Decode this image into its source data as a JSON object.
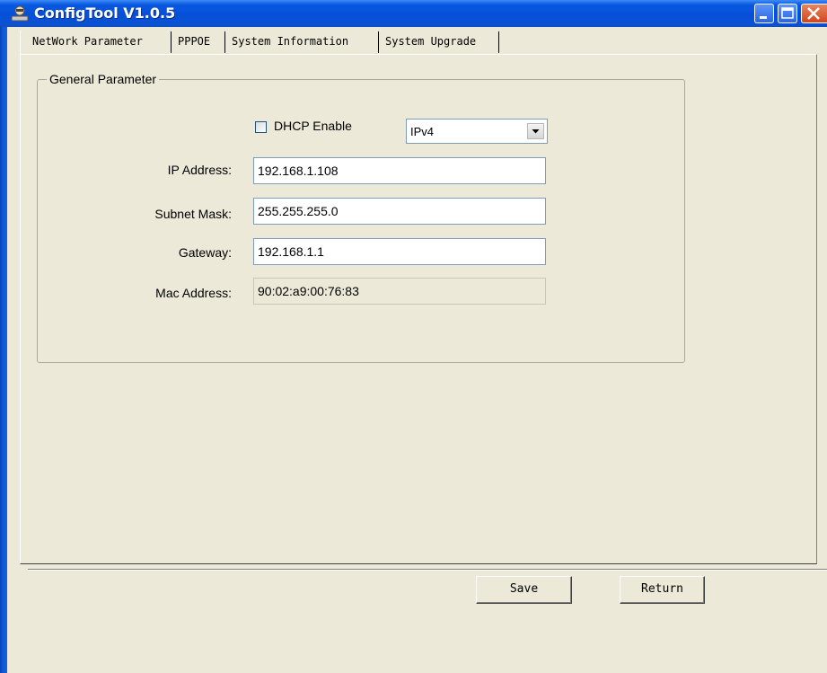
{
  "window": {
    "title": "ConfigTool V1.0.5",
    "icon": "network-tool-icon",
    "controls": [
      "minimize-icon",
      "maximize-icon",
      "close-icon"
    ]
  },
  "tabs": [
    {
      "label": "NetWork Parameter",
      "active": true
    },
    {
      "label": "PPPOE",
      "active": false
    },
    {
      "label": "System Information",
      "active": false
    },
    {
      "label": "System Upgrade",
      "active": false
    }
  ],
  "general": {
    "group_title": "General Parameter",
    "dhcp": {
      "label": "DHCP Enable",
      "checked": false
    },
    "ip_version": {
      "selected": "IPv4"
    },
    "fields": {
      "ip_address": {
        "label": "IP Address:",
        "value": "192.168.1.108"
      },
      "subnet_mask": {
        "label": "Subnet Mask:",
        "value": "255.255.255.0"
      },
      "gateway": {
        "label": "Gateway:",
        "value": "192.168.1.1"
      },
      "mac_address": {
        "label": "Mac Address:",
        "value": "90:02:a9:00:76:83",
        "readonly": true
      }
    }
  },
  "actions": {
    "save_label": "Save",
    "return_label": "Return"
  },
  "colors": {
    "titlebar": "#0a58e0",
    "client_bg": "#ece9d8",
    "field_border": "#7f9db9",
    "close_button": "#d4451c"
  }
}
